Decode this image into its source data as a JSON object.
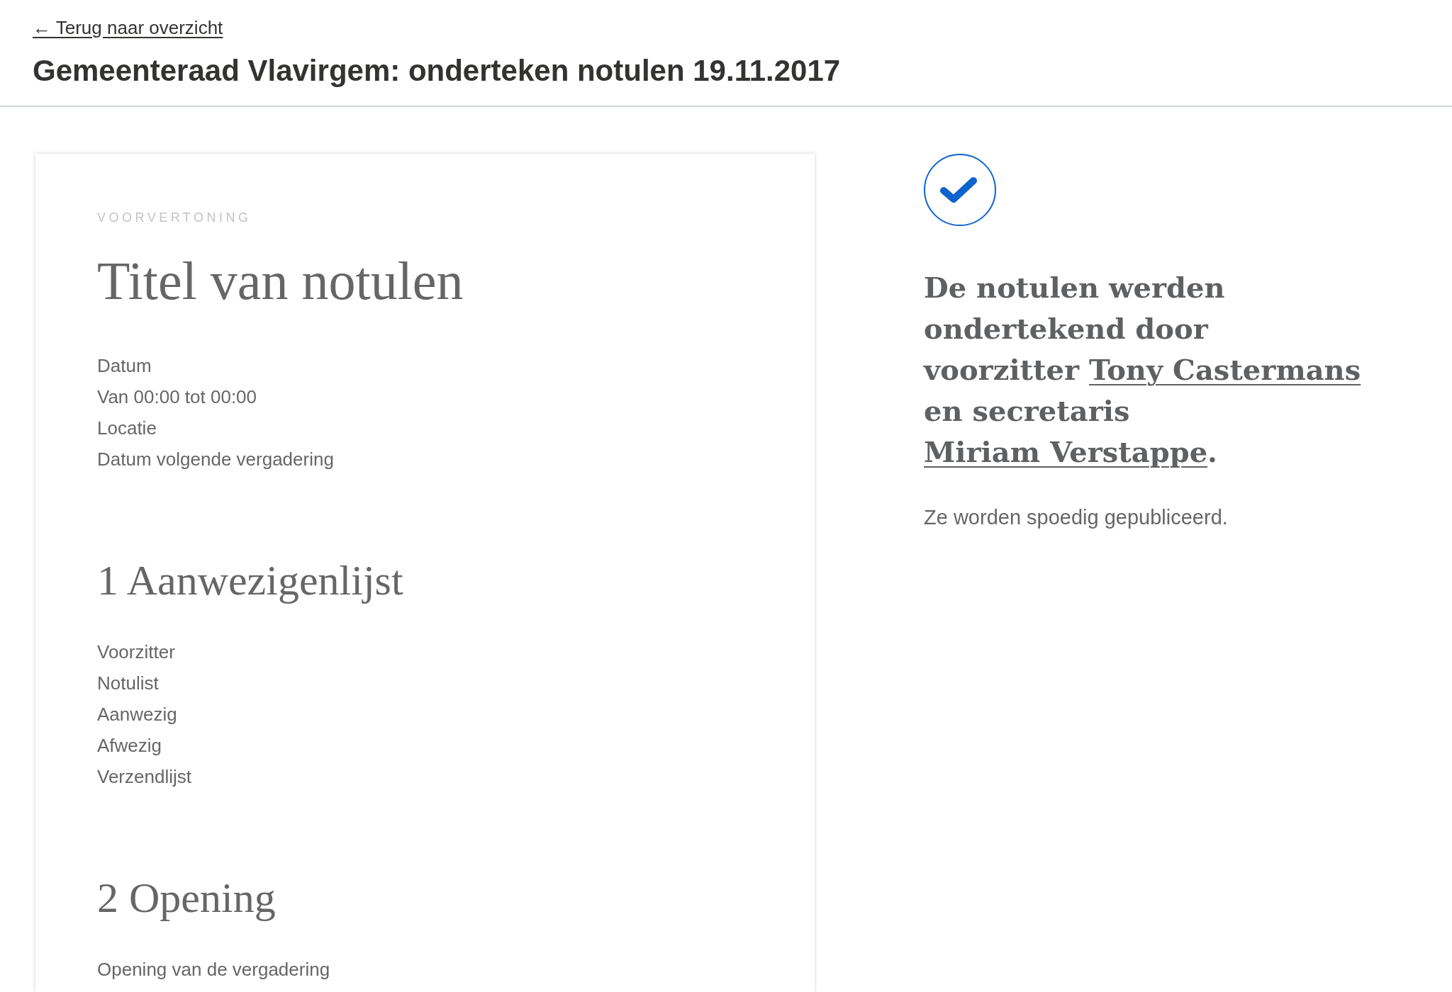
{
  "back_link": {
    "text": "← Terug naar overzicht"
  },
  "page_title": "Gemeenteraad Vlavirgem: onderteken notulen 19.11.2017",
  "preview": {
    "label": "VOORVERTONING",
    "title": "Titel van notulen",
    "meta": [
      "Datum",
      "Van 00:00 tot 00:00",
      "Locatie",
      "Datum volgende vergadering"
    ],
    "sections": [
      {
        "heading": "1 Aanwezigenlijst",
        "lines": [
          "Voorzitter",
          "Notulist",
          "Aanwezig",
          "Afwezig",
          "Verzendlijst"
        ]
      },
      {
        "heading": "2 Opening",
        "lines": [
          "Opening van de vergadering"
        ]
      }
    ]
  },
  "confirmation": {
    "message": [
      {
        "kind": "text",
        "text": "De notulen werden ondertekend door voorzitter "
      },
      {
        "kind": "link",
        "text": "Tony Castermans"
      },
      {
        "kind": "text",
        "text": " en secretaris "
      },
      {
        "kind": "link",
        "text": "Miriam Verstappe"
      },
      {
        "kind": "text",
        "text": "."
      }
    ],
    "note": "Ze worden spoedig gepubliceerd."
  }
}
